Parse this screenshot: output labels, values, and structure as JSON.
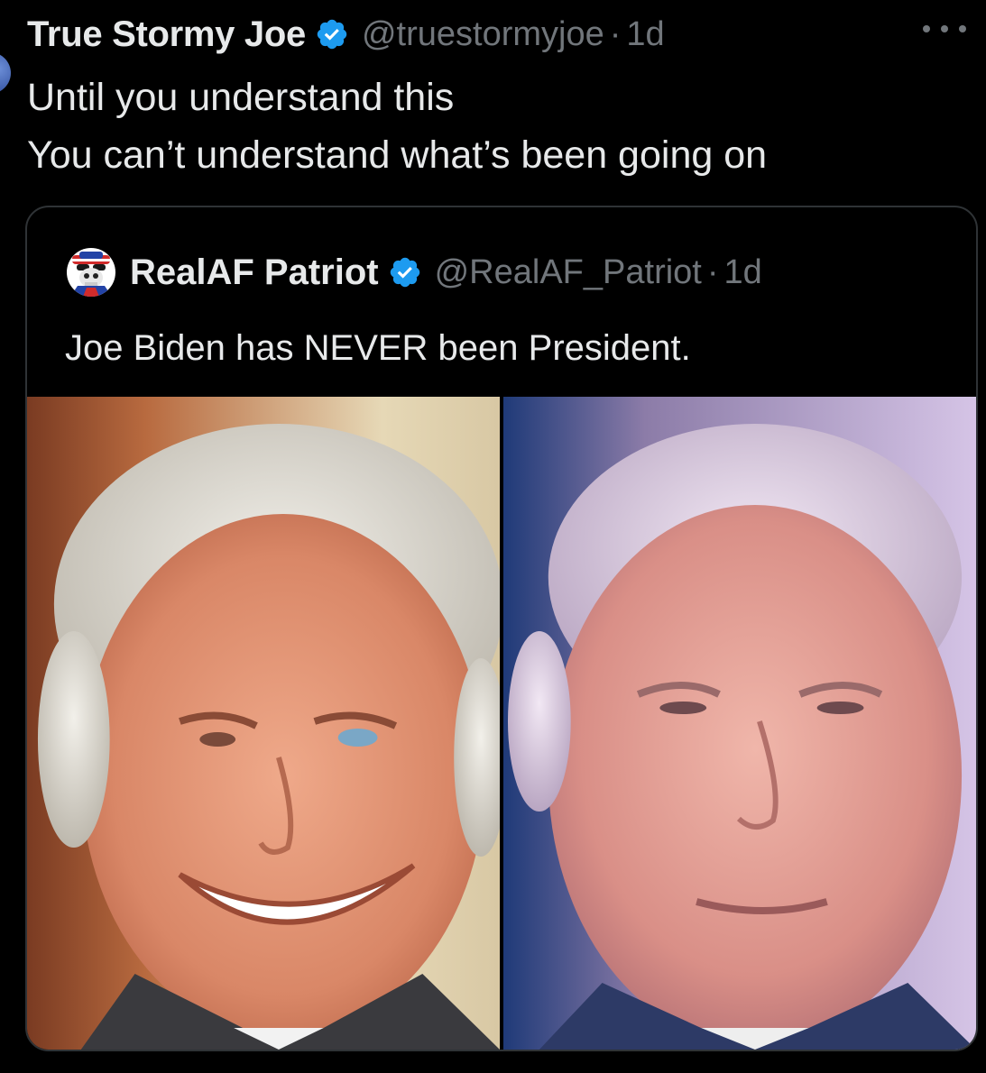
{
  "tweet": {
    "display_name": "True Stormy Joe",
    "handle": "@truestormyjoe",
    "separator": "·",
    "time": "1d",
    "verified_icon": "verified-badge-icon",
    "more_icon": "more-options-icon",
    "text_lines": [
      "Until you understand this",
      "You can’t understand what’s been going on"
    ]
  },
  "quoted_tweet": {
    "display_name": "RealAF Patriot",
    "handle": "@RealAF_Patriot",
    "separator": "·",
    "time": "1d",
    "avatar_icon": "patriot-skull-avatar",
    "verified_icon": "verified-badge-icon",
    "text": "Joe Biden has NEVER been President.",
    "photos": [
      {
        "name": "left-photo",
        "description_icon": "portrait-photo"
      },
      {
        "name": "right-photo",
        "description_icon": "portrait-photo"
      }
    ]
  },
  "colors": {
    "background": "#000000",
    "primary_text": "#e7e9ea",
    "secondary_text": "#71767b",
    "verified_blue": "#1d9bf0",
    "border": "#2f3336"
  }
}
